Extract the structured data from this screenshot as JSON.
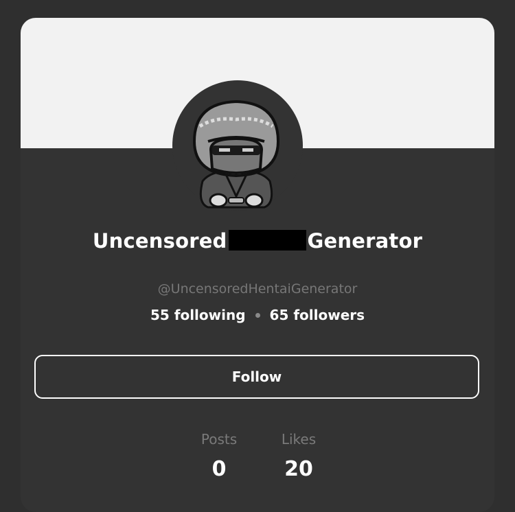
{
  "profile": {
    "name_before": "Uncensored",
    "name_after": "Generator",
    "handle": "@UncensoredHentaiGenerator",
    "following": "55 following",
    "followers": "65 followers"
  },
  "actions": {
    "follow_label": "Follow"
  },
  "metrics": {
    "posts_label": "Posts",
    "posts_value": "0",
    "likes_label": "Likes",
    "likes_value": "20"
  },
  "colors": {
    "background": "#2f2f2f",
    "card": "#333333",
    "banner": "#f2f2f2",
    "text_primary": "#ffffff",
    "text_muted": "#777777"
  },
  "icons": {
    "avatar": "hooded-ninja-avatar"
  }
}
